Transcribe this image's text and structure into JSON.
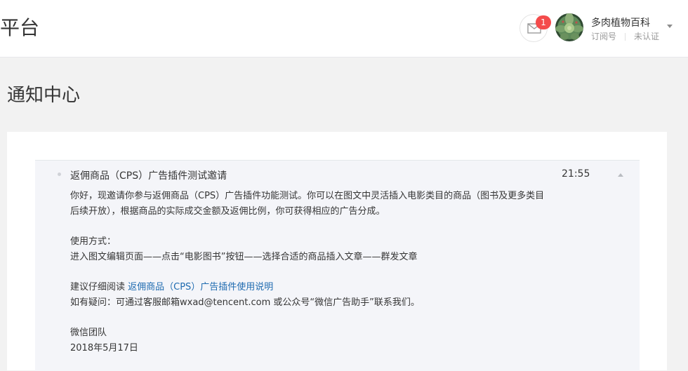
{
  "header": {
    "brand_fragment": "平台",
    "mail_badge": "1",
    "account": {
      "name": "多肉植物百科",
      "type": "订阅号",
      "status": "未认证"
    }
  },
  "page": {
    "title": "通知中心"
  },
  "notification": {
    "title": "返佣商品（CPS）广告插件测试邀请",
    "time": "21:55",
    "line1": "你好，现邀请你参与返佣商品（CPS）广告插件功能测试。你可以在图文中灵活插入电影类目的商品（图书及更多类目",
    "line2": "后续开放），根据商品的实际成交金额及返佣比例，你可获得相应的广告分成。",
    "usage_label": "使用方式：",
    "usage_steps": "进入图文编辑页面——点击“电影图书”按钮——选择合适的商品插入文章——群发文章",
    "read_prefix": "建议仔细阅读 ",
    "read_link": "返佣商品（CPS）广告插件使用说明",
    "contact": "如有疑问：可通过客服邮箱wxad@tencent.com 或公众号“微信广告助手”联系我们。",
    "signature": "微信团队",
    "date": "2018年5月17日"
  },
  "colors": {
    "badge": "#f44b4b",
    "link": "#1f6bb0",
    "message_bg": "#f4f5f9"
  },
  "icons": {
    "mail": "envelope-icon",
    "dropdown": "caret-down-icon",
    "collapse": "caret-up-icon"
  }
}
